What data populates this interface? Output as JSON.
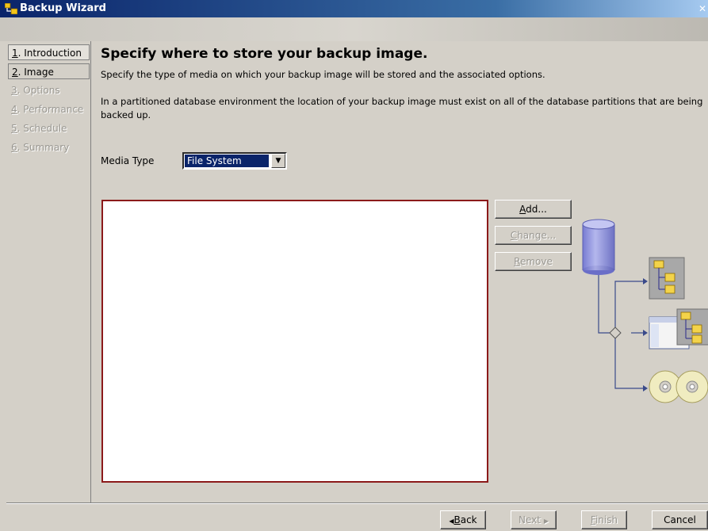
{
  "window": {
    "title": "Backup Wizard"
  },
  "nav": {
    "items": [
      {
        "num": "1",
        "label": ". Introduction",
        "state": "visited"
      },
      {
        "num": "2",
        "label": ". Image",
        "state": "current"
      },
      {
        "num": "3",
        "label": ". Options",
        "state": "disabled"
      },
      {
        "num": "4",
        "label": ". Performance",
        "state": "disabled"
      },
      {
        "num": "5",
        "label": ". Schedule",
        "state": "disabled"
      },
      {
        "num": "6",
        "label": ". Summary",
        "state": "disabled"
      }
    ]
  },
  "main": {
    "heading": "Specify where to store your backup image.",
    "description": "Specify the type of media on which your backup image will be stored and the associated options.",
    "note": "In a partitioned database environment the location of your backup image must exist on all of the database partitions that are being backed up.",
    "media_type_label": "Media Type",
    "media_type_value": "File System",
    "list_items": []
  },
  "side_buttons": {
    "add": {
      "u": "A",
      "rest": "dd..."
    },
    "change": {
      "u": "C",
      "rest": "hange..."
    },
    "remove": {
      "u": "R",
      "rest": "emove"
    }
  },
  "footer": {
    "back_arrow": "◀",
    "back_u": "B",
    "back_rest": "ack",
    "next": "Next",
    "next_arrow": "▶",
    "finish_u": "F",
    "finish_rest": "inish",
    "cancel": "Cancel"
  },
  "colors": {
    "titlebar_start": "#0a246a",
    "selection": "#0a246a",
    "list_border": "#8b1a1a",
    "database": "#8a8ee0"
  },
  "icons": {
    "app": "backup-wizard-icon",
    "close": "close-icon",
    "dropdown": "chevron-down-icon",
    "database": "database-icon",
    "folder_tree": "folder-tree-icon",
    "window_folder": "window-folder-icon",
    "cd": "cd-disc-icon"
  }
}
